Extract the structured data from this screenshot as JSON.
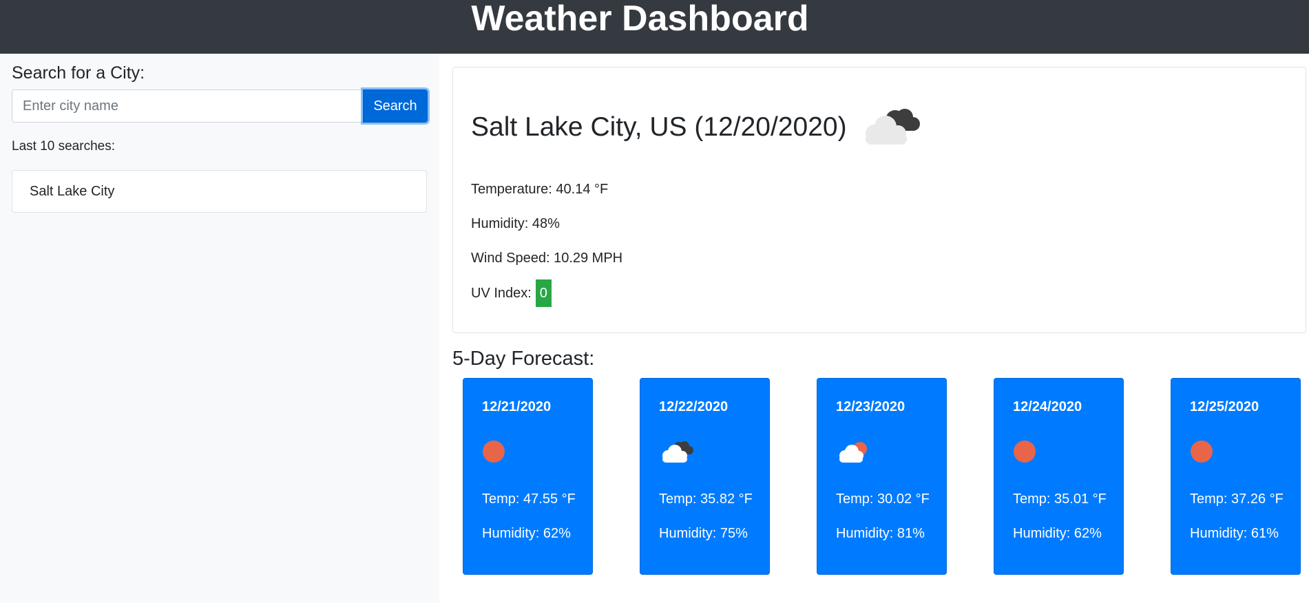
{
  "header": {
    "title": "Weather Dashboard"
  },
  "sidebar": {
    "search_title": "Search for a City:",
    "search_placeholder": "Enter city name",
    "search_button_label": "Search",
    "history_label": "Last 10 searches:",
    "history": [
      {
        "label": "Salt Lake City"
      }
    ]
  },
  "current": {
    "title": "Salt Lake City, US (12/20/2020)",
    "icon": "broken-clouds-icon",
    "temperature": "Temperature: 40.14 °F",
    "humidity": "Humidity: 48%",
    "wind": "Wind Speed: 10.29 MPH",
    "uv_label": "UV Index:",
    "uv_value": "0",
    "uv_color": "#28a745"
  },
  "forecast": {
    "title": "5-Day Forecast:",
    "days": [
      {
        "date": "12/21/2020",
        "icon": "clear-sky-icon",
        "temp": "Temp: 47.55 °F",
        "humidity": "Humidity: 62%"
      },
      {
        "date": "12/22/2020",
        "icon": "broken-clouds-icon",
        "temp": "Temp: 35.82 °F",
        "humidity": "Humidity: 75%"
      },
      {
        "date": "12/23/2020",
        "icon": "few-clouds-icon",
        "temp": "Temp: 30.02 °F",
        "humidity": "Humidity: 81%"
      },
      {
        "date": "12/24/2020",
        "icon": "clear-sky-icon",
        "temp": "Temp: 35.01 °F",
        "humidity": "Humidity: 62%"
      },
      {
        "date": "12/25/2020",
        "icon": "clear-sky-icon",
        "temp": "Temp: 37.26 °F",
        "humidity": "Humidity: 61%"
      }
    ]
  },
  "colors": {
    "header_bg": "#343a40",
    "sidebar_bg": "#f8f9fa",
    "primary": "#007bff",
    "button": "#0069d9",
    "sun": "#e8654a"
  }
}
